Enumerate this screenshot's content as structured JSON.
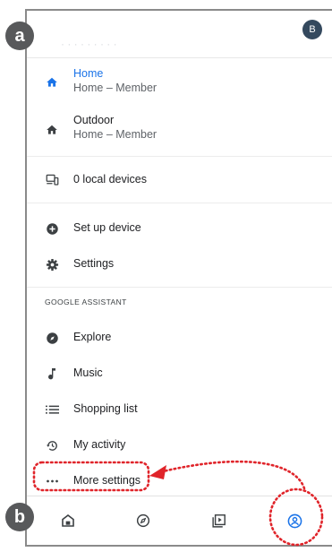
{
  "badges": {
    "a": "a",
    "b": "b"
  },
  "header": {
    "avatar_letter": "B",
    "faded_text": "· · · · · · · · ·"
  },
  "homes": [
    {
      "title": "Home",
      "subtitle": "Home – Member",
      "icon": "home-icon"
    },
    {
      "title": "Outdoor",
      "subtitle": "Home – Member",
      "icon": "home-icon"
    }
  ],
  "local_devices": {
    "label": "0 local devices",
    "icon": "local-devices-icon"
  },
  "menu": [
    {
      "label": "Set up device",
      "icon": "add-circle-icon"
    },
    {
      "label": "Settings",
      "icon": "gear-icon"
    }
  ],
  "assistant": {
    "section_label": "GOOGLE ASSISTANT",
    "items": [
      {
        "label": "Explore",
        "icon": "compass-icon"
      },
      {
        "label": "Music",
        "icon": "music-note-icon"
      },
      {
        "label": "Shopping list",
        "icon": "list-icon"
      },
      {
        "label": "My activity",
        "icon": "history-icon"
      },
      {
        "label": "More settings",
        "icon": "more-horiz-icon"
      }
    ]
  },
  "bottom_nav": [
    "home-icon",
    "compass-icon",
    "video-library-icon",
    "account-icon"
  ],
  "colors": {
    "accent": "#1a73e8",
    "annotation": "#e0242a",
    "badge": "#58595b",
    "avatar": "#34495e"
  }
}
